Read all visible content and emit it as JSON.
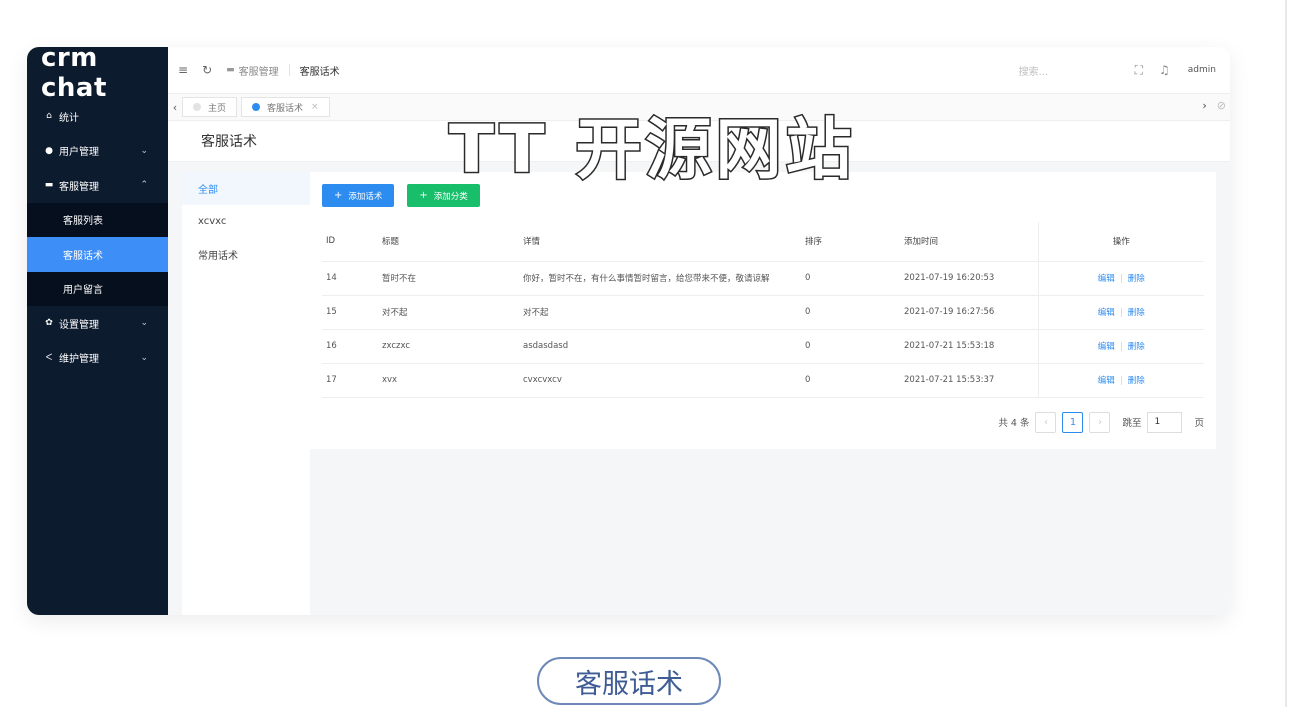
{
  "logo": "crm chat",
  "sidebar": {
    "items": [
      {
        "label": "统计",
        "icon": "home-icon"
      },
      {
        "label": "用户管理",
        "icon": "user-icon",
        "arrow": "⌄"
      },
      {
        "label": "客服管理",
        "icon": "chat-icon",
        "arrow": "⌃"
      },
      {
        "label": "设置管理",
        "icon": "gear-icon",
        "arrow": "⌄"
      },
      {
        "label": "维护管理",
        "icon": "wrench-icon",
        "arrow": "⌄"
      }
    ],
    "sub_items": [
      {
        "label": "客服列表"
      },
      {
        "label": "客服话术"
      },
      {
        "label": "用户留言"
      }
    ]
  },
  "topbar": {
    "breadcrumb_parent": "客服管理",
    "breadcrumb_current": "客服话术",
    "search_placeholder": "搜索...",
    "user": "admin"
  },
  "tabs": [
    {
      "label": "主页"
    },
    {
      "label": "客服话术"
    }
  ],
  "page_title": "客服话术",
  "categories": [
    "全部",
    "xcvxc",
    "常用话术"
  ],
  "buttons": {
    "add_phrase": "添加话术",
    "add_category": "添加分类"
  },
  "table": {
    "headers": [
      "ID",
      "标题",
      "详情",
      "排序",
      "添加时间",
      "操作"
    ],
    "rows": [
      {
        "id": "14",
        "title": "暂时不在",
        "detail": "你好，暂时不在，有什么事情暂时留言，给您带来不便，敬请谅解",
        "sort": "0",
        "time": "2021-07-19 16:20:53"
      },
      {
        "id": "15",
        "title": "对不起",
        "detail": "对不起",
        "sort": "0",
        "time": "2021-07-19 16:27:56"
      },
      {
        "id": "16",
        "title": "zxczxc",
        "detail": "asdasdasd",
        "sort": "0",
        "time": "2021-07-21 15:53:18"
      },
      {
        "id": "17",
        "title": "xvx",
        "detail": "cvxcvxcv",
        "sort": "0",
        "time": "2021-07-21 15:53:37"
      }
    ],
    "edit_label": "编辑",
    "delete_label": "删除"
  },
  "pager": {
    "total": "共 4 条",
    "current_page": "1",
    "goto_label": "跳至",
    "goto_value": "1",
    "page_unit": "页"
  },
  "watermark": "TT 开源网站",
  "caption": "客服话术"
}
